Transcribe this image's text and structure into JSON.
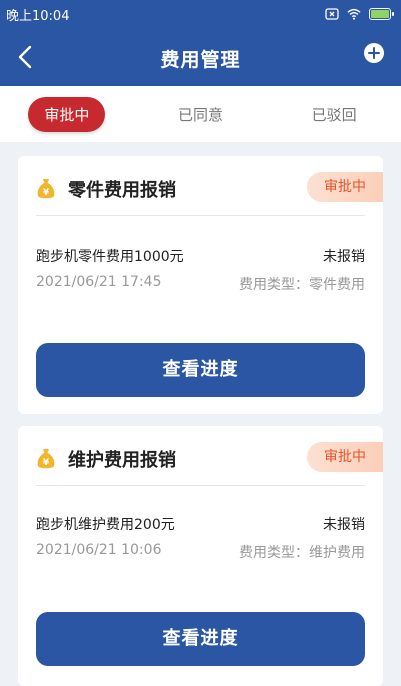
{
  "status_bar": {
    "time": "晚上10:04"
  },
  "nav": {
    "title": "费用管理"
  },
  "tabs": [
    {
      "label": "审批中",
      "active": true
    },
    {
      "label": "已同意",
      "active": false
    },
    {
      "label": "已驳回",
      "active": false
    }
  ],
  "colors": {
    "primary": "#2b56a3",
    "active_tab": "#c62a2e",
    "badge_text": "#e5542c"
  },
  "cards": [
    {
      "title": "零件费用报销",
      "status": "审批中",
      "description": "跑步机零件费用1000元",
      "claim_status": "未报销",
      "datetime": "2021/06/21 17:45",
      "expense_type": "费用类型：零件费用",
      "button_label": "查看进度"
    },
    {
      "title": "维护费用报销",
      "status": "审批中",
      "description": "跑步机维护费用200元",
      "claim_status": "未报销",
      "datetime": "2021/06/21 10:06",
      "expense_type": "费用类型：维护费用",
      "button_label": "查看进度"
    }
  ]
}
